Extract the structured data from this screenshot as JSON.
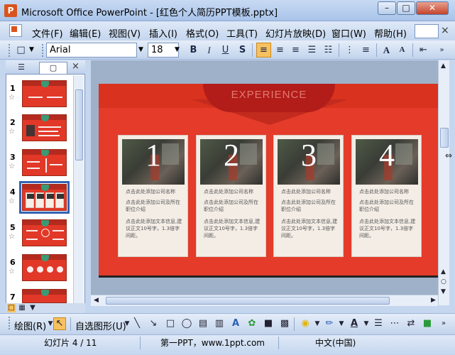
{
  "window": {
    "title": "Microsoft Office PowerPoint - [红色个人简历PPT模板.pptx]",
    "minimize": "–",
    "maximize": "□",
    "close": "✕"
  },
  "menu": {
    "items": [
      {
        "label": "文件(F)"
      },
      {
        "label": "编辑(E)"
      },
      {
        "label": "视图(V)"
      },
      {
        "label": "插入(I)"
      },
      {
        "label": "格式(O)"
      },
      {
        "label": "工具(T)"
      },
      {
        "label": "幻灯片放映(D)"
      },
      {
        "label": "窗口(W)"
      },
      {
        "label": "帮助(H)"
      }
    ],
    "close_doc": "×"
  },
  "toolbar": {
    "font": "Arial",
    "font_size": "18",
    "bold": "B",
    "italic": "I",
    "underline": "U",
    "shadow": "S",
    "grow_font": "A",
    "shrink_font": "A"
  },
  "panel": {
    "tab_outline": "☰",
    "tab_slides": "▢",
    "close": "×",
    "slides": [
      {
        "num": "1"
      },
      {
        "num": "2"
      },
      {
        "num": "3"
      },
      {
        "num": "4"
      },
      {
        "num": "5"
      },
      {
        "num": "6"
      },
      {
        "num": "7"
      }
    ],
    "selected_slide": 4
  },
  "slide": {
    "heading": "EXPERIENCE",
    "cards": [
      {
        "number": "1",
        "line1": "点击此处添加公司名称",
        "line2": "点击此处添加公司及所在职位介绍",
        "line3": "点击此处添加文本信息,建议正文10号字，1.3倍字间距。"
      },
      {
        "number": "2",
        "line1": "点击此处添加公司名称",
        "line2": "点击此处添加公司及所在职位介绍",
        "line3": "点击此处添加文本信息,建议正文10号字，1.3倍字间距。"
      },
      {
        "number": "3",
        "line1": "点击此处添加公司名称",
        "line2": "点击此处添加公司及所在职位介绍",
        "line3": "点击此处添加文本信息,建议正文10号字，1.3倍字间距。"
      },
      {
        "number": "4",
        "line1": "点击此处添加公司名称",
        "line2": "点击此处添加公司及所在职位介绍",
        "line3": "点击此处添加文本信息,建议正文10号字，1.3倍字间距。"
      }
    ]
  },
  "drawbar": {
    "draw_label": "绘图(R)",
    "autoshapes_label": "自选图形(U)"
  },
  "status": {
    "slide_info": "幻灯片 4 / 11",
    "design": "第一PPT，www.1ppt.com",
    "language": "中文(中国)"
  },
  "colors": {
    "slide_red": "#e43b2a",
    "selection_blue": "#3463b4",
    "active_button": "#f7c15f"
  }
}
